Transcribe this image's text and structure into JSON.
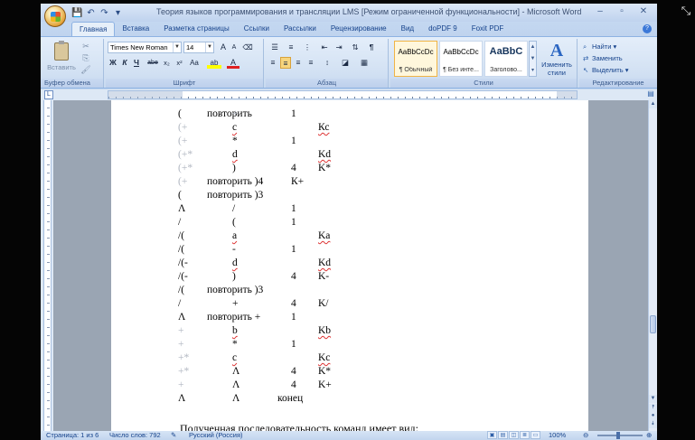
{
  "window": {
    "title": "Теория языков программирования и трансляции LMS [Режим ограниченной функциональности] - Microsoft Word",
    "minimize": "‒",
    "maximize": "▫",
    "close": "✕"
  },
  "ribbon_tabs": [
    "Главная",
    "Вставка",
    "Разметка страницы",
    "Ссылки",
    "Рассылки",
    "Рецензирование",
    "Вид",
    "doPDF 9",
    "Foxit PDF"
  ],
  "clipboard": {
    "paste_label": "Вставить",
    "group_label": "Буфер обмена"
  },
  "font": {
    "family_value": "Times New Roman",
    "size_value": "14",
    "group_label": "Шрифт",
    "grow": "A",
    "shrink": "A",
    "clear": "⌫",
    "bold": "Ж",
    "italic": "К",
    "underline": "Ч",
    "strike": "abe",
    "subscript": "x₂",
    "superscript": "x²",
    "case": "Aa",
    "highlight": "ab",
    "color": "A"
  },
  "paragraph": {
    "group_label": "Абзац",
    "pilcrow": "¶"
  },
  "styles": {
    "group_label": "Стили",
    "items": [
      {
        "sample": "AaBbCcDc",
        "name": "¶ Обычный"
      },
      {
        "sample": "AaBbCcDc",
        "name": "¶ Без инте..."
      },
      {
        "sample": "AaBbC",
        "name": "Заголово..."
      }
    ],
    "change_label_1": "Изменить",
    "change_label_2": "стили"
  },
  "editing": {
    "group_label": "Редактирование",
    "find": "Найти",
    "replace": "Заменить",
    "select": "Выделить"
  },
  "document": {
    "rows": [
      {
        "c1": "(",
        "c2": "повторить",
        "c2b": "+",
        "c3": "1",
        "c4": ""
      },
      {
        "c1": "(+",
        "c2": "с",
        "c2b": "",
        "c3": "",
        "c4": "Кс"
      },
      {
        "c1": "(+",
        "c2": "*",
        "c2b": "",
        "c3": "1",
        "c4": ""
      },
      {
        "c1": "(+*",
        "c2": "d",
        "c2b": "",
        "c3": "",
        "c4": "Kd"
      },
      {
        "c1": "(+*",
        "c2": ")",
        "c2b": "",
        "c3": "4",
        "c4": "K*"
      },
      {
        "c1": "(+",
        "c2": "повторить )4",
        "c2b": "",
        "c3": "К+",
        "c4": ""
      },
      {
        "c1": "(",
        "c2": "повторить )3",
        "c2b": "",
        "c3": "",
        "c4": ""
      },
      {
        "c1": "Λ",
        "c2": "/",
        "c2b": "",
        "c3": "1",
        "c4": ""
      },
      {
        "c1": "/",
        "c2": "(",
        "c2b": "",
        "c3": "1",
        "c4": ""
      },
      {
        "c1": "/(",
        "c2": "a",
        "c2b": "",
        "c3": "",
        "c4": "Ka"
      },
      {
        "c1": "/(",
        "c2": "-",
        "c2b": "",
        "c3": "1",
        "c4": ""
      },
      {
        "c1": "/(-",
        "c2": "d",
        "c2b": "",
        "c3": "",
        "c4": "Kd"
      },
      {
        "c1": "/(-",
        "c2": ")",
        "c2b": "",
        "c3": "4",
        "c4": "K-"
      },
      {
        "c1": "/(",
        "c2": "повторить )3",
        "c2b": "",
        "c3": "",
        "c4": ""
      },
      {
        "c1": "/",
        "c2": "+",
        "c2b": "",
        "c3": "4",
        "c4": "K/"
      },
      {
        "c1": "Λ",
        "c2": "повторить +",
        "c2b": "",
        "c3": "1",
        "c4": ""
      },
      {
        "c1": "+",
        "c2": "b",
        "c2b": "",
        "c3": "",
        "c4": "Kb"
      },
      {
        "c1": "+",
        "c2": "*",
        "c2b": "",
        "c3": "1",
        "c4": ""
      },
      {
        "c1": "+*",
        "c2": "c",
        "c2b": "",
        "c3": "",
        "c4": "Kc"
      },
      {
        "c1": "+*",
        "c2": "Λ",
        "c2b": "",
        "c3": "4",
        "c4": "K*"
      },
      {
        "c1": "+",
        "c2": "Λ",
        "c2b": "",
        "c3": "4",
        "c4": "K+"
      },
      {
        "c1": "Λ",
        "c2": "Λ",
        "c2b": "",
        "c3": "конец",
        "c4": ""
      }
    ],
    "caption": "Полученная последовательность команд имеет вид:"
  },
  "statusbar": {
    "page": "Страница: 1 из 6",
    "words": "Число слов: 792",
    "language": "Русский (Россия)",
    "zoom": "100%"
  }
}
